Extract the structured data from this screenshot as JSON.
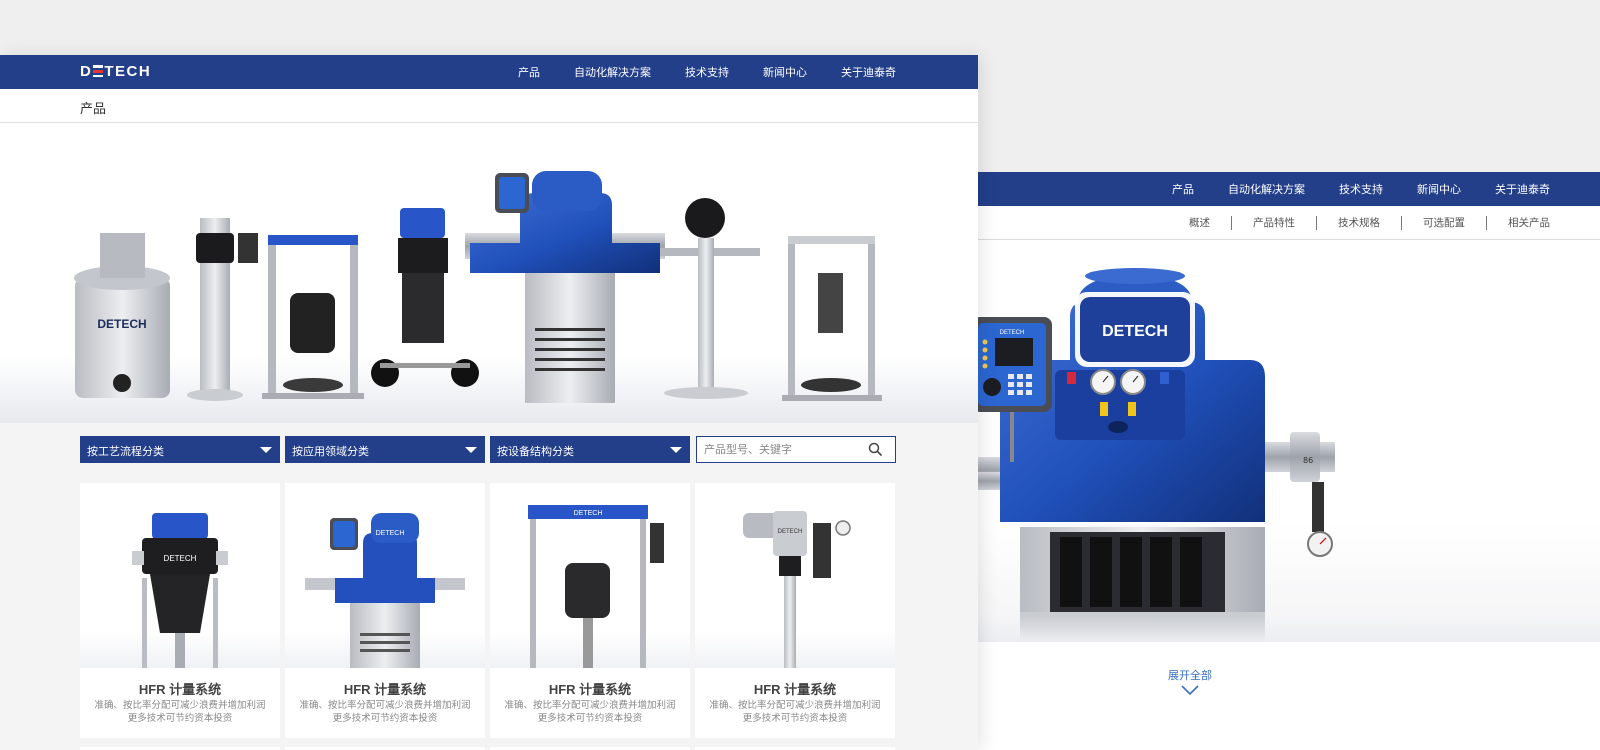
{
  "brand": {
    "logo_text_left": "D",
    "logo_text_right": "TECH",
    "nav_color": "#233f8a",
    "accent_red": "#e53935"
  },
  "left_window": {
    "nav": [
      "产品",
      "自动化解决方案",
      "技术支持",
      "新闻中心",
      "关于迪泰奇"
    ],
    "page_title": "产品",
    "banner_label": "DETECH",
    "filters": [
      {
        "label": "按工艺流程分类"
      },
      {
        "label": "按应用领域分类"
      },
      {
        "label": "按设备结构分类"
      }
    ],
    "search": {
      "placeholder": "产品型号、关键字"
    },
    "cards": [
      {
        "title": "HFR 计量系统",
        "desc": "准确、按比率分配可减少浪费并增加利润更多技术可节约资本投资",
        "machine": "DETECH"
      },
      {
        "title": "HFR 计量系统",
        "desc": "准确、按比率分配可减少浪费并增加利润更多技术可节约资本投资",
        "machine": "DETECH"
      },
      {
        "title": "HFR 计量系统",
        "desc": "准确、按比率分配可减少浪费并增加利润更多技术可节约资本投资",
        "machine": "DETECH"
      },
      {
        "title": "HFR 计量系统",
        "desc": "准确、按比率分配可减少浪费并增加利润更多技术可节约资本投资",
        "machine": "DETECH"
      }
    ]
  },
  "right_window": {
    "nav": [
      "产品",
      "自动化解决方案",
      "技术支持",
      "新闻中心",
      "关于迪泰奇"
    ],
    "subnav": [
      "概述",
      "产品特性",
      "技术规格",
      "可选配置",
      "相关产品"
    ],
    "product_logo": "DETECH",
    "controller_logo": "DETECH",
    "gauge_number": "86",
    "expand_label": "展开全部"
  }
}
